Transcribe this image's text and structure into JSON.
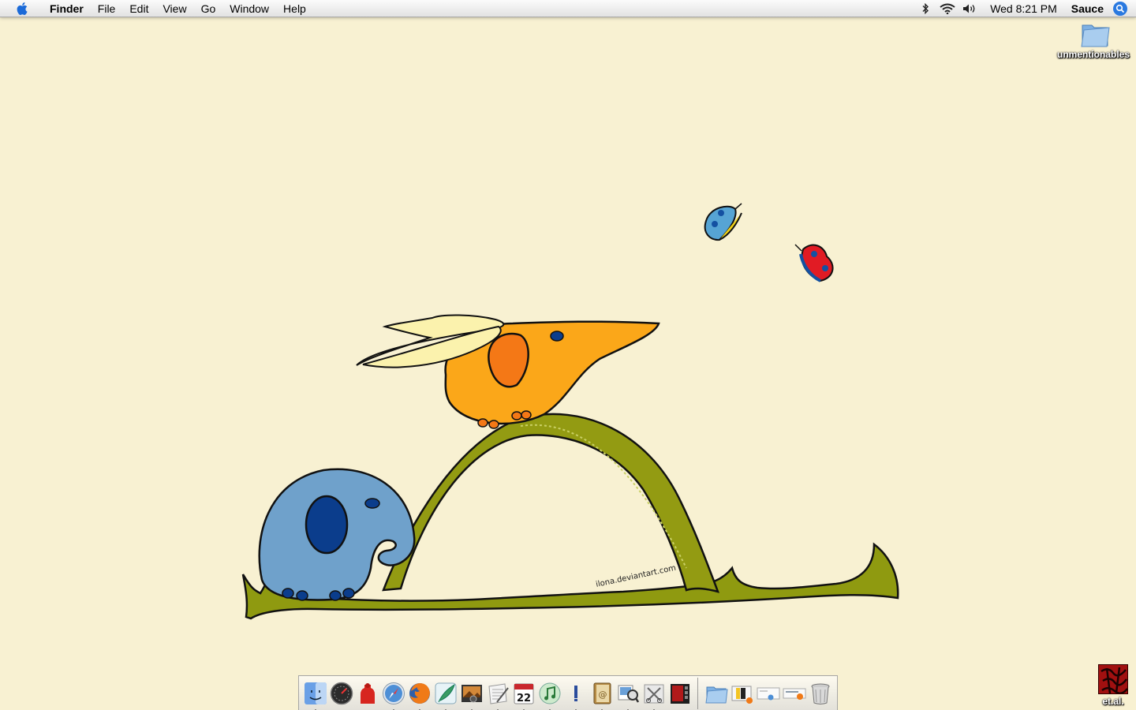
{
  "menubar": {
    "apple_icon": "apple-logo-icon",
    "app_name": "Finder",
    "items": [
      {
        "label": "File"
      },
      {
        "label": "Edit"
      },
      {
        "label": "View"
      },
      {
        "label": "Go"
      },
      {
        "label": "Window"
      },
      {
        "label": "Help"
      }
    ],
    "status": {
      "bluetooth_icon": "bluetooth-icon",
      "wifi_icon": "wifi-icon",
      "volume_icon": "volume-icon",
      "clock": "Wed 8:21 PM",
      "user": "Sauce",
      "spotlight_icon": "spotlight-icon"
    }
  },
  "desktop": {
    "icons": [
      {
        "label": "unmentionables",
        "icon": "folder-icon"
      },
      {
        "label": "et.al.",
        "icon": "image-file-icon"
      }
    ],
    "wallpaper": {
      "signature": "ilona.deviantart.com",
      "background_color": "#f8f1d2"
    }
  },
  "dock": {
    "apps": [
      {
        "name": "finder-icon",
        "running": true
      },
      {
        "name": "dashboard-icon",
        "running": false
      },
      {
        "name": "firestarter-icon",
        "running": false
      },
      {
        "name": "safari-icon",
        "running": true
      },
      {
        "name": "firefox-icon",
        "running": true
      },
      {
        "name": "feather-app-icon",
        "running": true
      },
      {
        "name": "photo-app-icon",
        "running": true
      },
      {
        "name": "textedit-icon",
        "running": true
      },
      {
        "name": "ical-icon",
        "running": true,
        "text": "22"
      },
      {
        "name": "itunes-icon",
        "running": true
      },
      {
        "name": "terminal-icon",
        "running": true
      },
      {
        "name": "address-book-icon",
        "running": true
      },
      {
        "name": "preview-icon",
        "running": true
      },
      {
        "name": "script-editor-icon",
        "running": true
      },
      {
        "name": "photo-booth-icon",
        "running": false
      }
    ],
    "documents": [
      {
        "name": "stack-folder-icon"
      },
      {
        "name": "document-thumbnail-1"
      },
      {
        "name": "document-thumbnail-2"
      },
      {
        "name": "document-thumbnail-3"
      },
      {
        "name": "trash-icon"
      }
    ]
  }
}
